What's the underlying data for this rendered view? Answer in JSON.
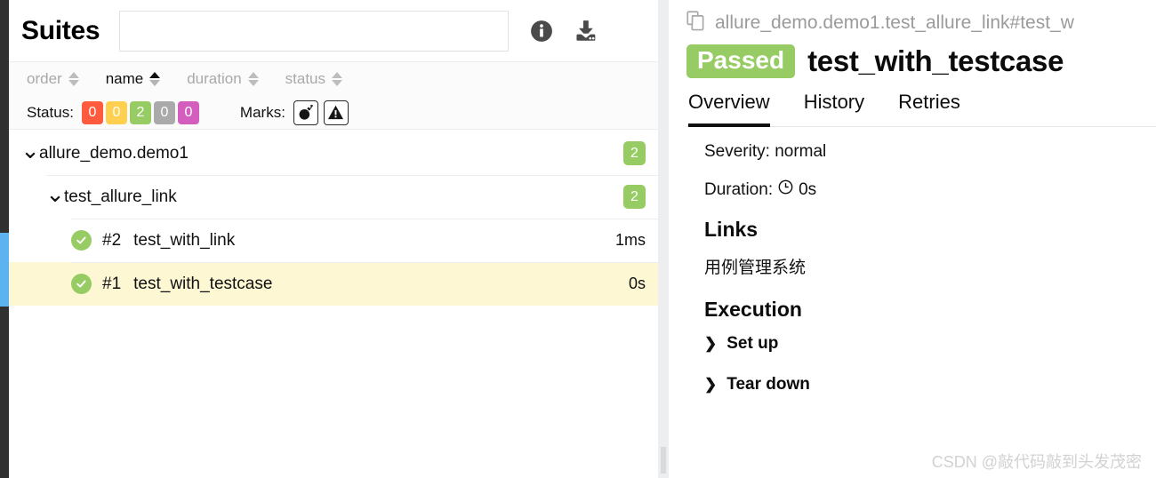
{
  "left": {
    "title": "Suites",
    "search": {
      "value": "",
      "placeholder": ""
    },
    "icons": {
      "info": "info-icon",
      "download": "download-icon"
    },
    "sort": {
      "items": [
        {
          "label": "order",
          "active": false
        },
        {
          "label": "name",
          "active": true
        },
        {
          "label": "duration",
          "active": false
        },
        {
          "label": "status",
          "active": false
        }
      ]
    },
    "filters": {
      "status_label": "Status:",
      "status_chips": [
        {
          "value": "0",
          "color": "#fd5a3e",
          "name": "failed"
        },
        {
          "value": "0",
          "color": "#ffd050",
          "name": "broken"
        },
        {
          "value": "2",
          "color": "#97cc64",
          "name": "passed"
        },
        {
          "value": "0",
          "color": "#aaaaaa",
          "name": "skipped"
        },
        {
          "value": "0",
          "color": "#d35ebe",
          "name": "unknown"
        }
      ],
      "marks_label": "Marks:",
      "marks": [
        {
          "name": "bomb-icon"
        },
        {
          "name": "warning-icon"
        }
      ]
    },
    "tree": [
      {
        "type": "group",
        "depth": 0,
        "label": "allure_demo.demo1",
        "count": "2",
        "expanded": true
      },
      {
        "type": "group",
        "depth": 1,
        "label": "test_allure_link",
        "count": "2",
        "expanded": true
      },
      {
        "type": "leaf",
        "depth": 2,
        "status": "passed",
        "order": "#2",
        "label": "test_with_link",
        "duration": "1ms",
        "selected": false
      },
      {
        "type": "leaf",
        "depth": 2,
        "status": "passed",
        "order": "#1",
        "label": "test_with_testcase",
        "duration": "0s",
        "selected": true
      }
    ]
  },
  "right": {
    "breadcrumb": "allure_demo.demo1.test_allure_link#test_w",
    "breadcrumb_icon": "copy-pages-icon",
    "status": "Passed",
    "status_color": "#97cc64",
    "title": "test_with_testcase",
    "tabs": [
      {
        "label": "Overview",
        "active": true
      },
      {
        "label": "History",
        "active": false
      },
      {
        "label": "Retries",
        "active": false
      }
    ],
    "severity": "Severity: normal",
    "duration_label": "Duration:",
    "duration_value": "0s",
    "links_heading": "Links",
    "links": [
      {
        "label": "用例管理系统"
      }
    ],
    "execution_heading": "Execution",
    "execution_rows": [
      {
        "label": "Set up",
        "expanded": false
      },
      {
        "label": "Tear down",
        "expanded": false
      }
    ]
  },
  "watermark": "CSDN @敲代码敲到头发茂密"
}
